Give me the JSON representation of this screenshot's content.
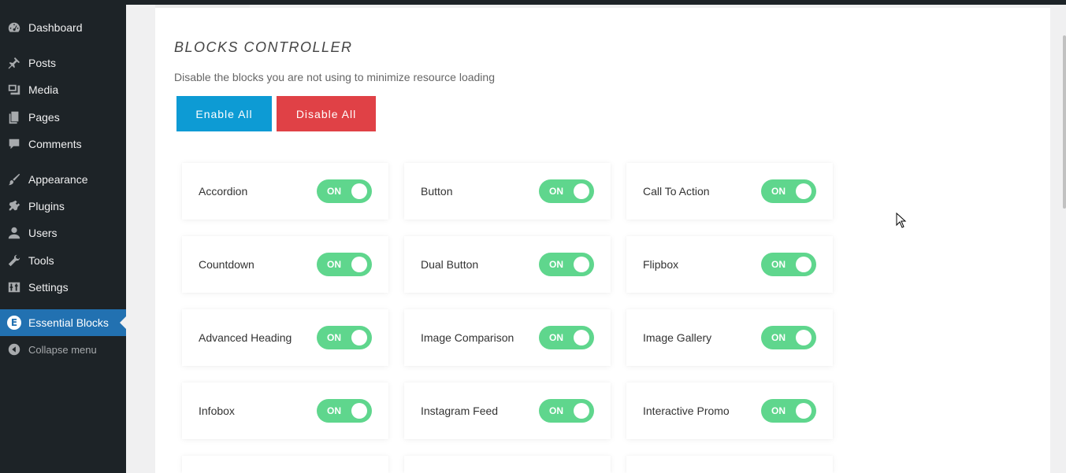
{
  "sidebar": {
    "items": [
      {
        "label": "Dashboard",
        "icon": "dashboard-icon"
      },
      {
        "label": "Posts",
        "icon": "pin-icon"
      },
      {
        "label": "Media",
        "icon": "media-icon"
      },
      {
        "label": "Pages",
        "icon": "pages-icon"
      },
      {
        "label": "Comments",
        "icon": "comment-icon"
      },
      {
        "label": "Appearance",
        "icon": "brush-icon"
      },
      {
        "label": "Plugins",
        "icon": "plug-icon"
      },
      {
        "label": "Users",
        "icon": "user-icon"
      },
      {
        "label": "Tools",
        "icon": "wrench-icon"
      },
      {
        "label": "Settings",
        "icon": "sliders-icon"
      },
      {
        "label": "Essential Blocks",
        "icon": "essential-blocks-icon"
      },
      {
        "label": "Collapse menu",
        "icon": "collapse-icon"
      }
    ]
  },
  "main": {
    "title": "BLOCKS CONTROLLER",
    "description": "Disable the blocks you are not using to minimize resource loading",
    "enable_all": "Enable All",
    "disable_all": "Disable All",
    "toggle_on": "ON",
    "blocks": [
      "Accordion",
      "Button",
      "Call To Action",
      "Countdown",
      "Dual Button",
      "Flipbox",
      "Advanced Heading",
      "Image Comparison",
      "Image Gallery",
      "Infobox",
      "Instagram Feed",
      "Interactive Promo"
    ]
  },
  "colors": {
    "sidebar_bg": "#1d2327",
    "active_bg": "#2271b1",
    "enable_btn": "#0d9bd4",
    "disable_btn": "#e04146",
    "toggle_on": "#5fd68d"
  }
}
